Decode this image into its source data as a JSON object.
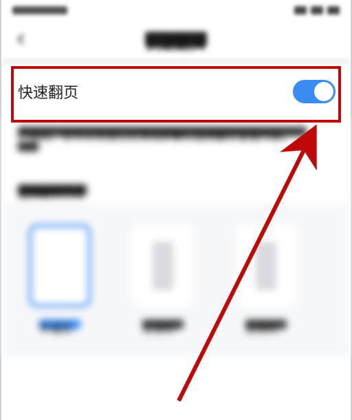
{
  "statusbar": {
    "time_placeholder": "",
    "icons": [
      "signal",
      "wifi",
      "battery"
    ]
  },
  "nav": {
    "back_label": "返回",
    "title": "快速翻页"
  },
  "setting": {
    "label": "快速翻页",
    "toggle_on": true
  },
  "description": {
    "text": "开启后，您可以快速左右滑动屏幕以连续翻页查看内容。"
  },
  "mode_section": {
    "title": "选择翻页方式"
  },
  "options": [
    {
      "label": "平铺页",
      "selected": true
    },
    {
      "label": "左侧栏",
      "selected": false
    },
    {
      "label": "右侧栏",
      "selected": false
    }
  ],
  "annotation": {
    "highlight_target": "快速翻页 toggle row",
    "arrow_points_to": "toggle switch"
  },
  "colors": {
    "accent": "#3b8cf2",
    "highlight": "#c00808"
  }
}
